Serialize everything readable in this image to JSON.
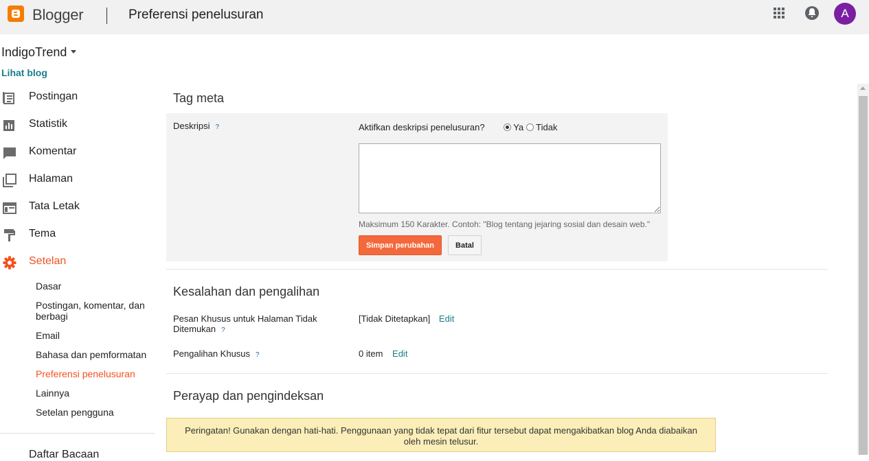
{
  "header": {
    "brand": "Blogger",
    "title": "Preferensi penelusuran",
    "avatar_initial": "A",
    "accent_color": "#f57d00",
    "avatar_color": "#7b1fa2"
  },
  "sidebar": {
    "blog_name": "IndigoTrend",
    "view_blog": "Lihat blog",
    "items": [
      {
        "label": "Postingan",
        "icon": "posts-icon"
      },
      {
        "label": "Statistik",
        "icon": "stats-icon"
      },
      {
        "label": "Komentar",
        "icon": "comments-icon"
      },
      {
        "label": "Halaman",
        "icon": "pages-icon"
      },
      {
        "label": "Tata Letak",
        "icon": "layout-icon"
      },
      {
        "label": "Tema",
        "icon": "theme-icon"
      },
      {
        "label": "Setelan",
        "icon": "gear-icon",
        "active": true
      }
    ],
    "subitems": [
      {
        "label": "Dasar"
      },
      {
        "label": "Postingan, komentar, dan berbagi"
      },
      {
        "label": "Email"
      },
      {
        "label": "Bahasa dan pemformatan"
      },
      {
        "label": "Preferensi penelusuran",
        "active": true
      },
      {
        "label": "Lainnya"
      },
      {
        "label": "Setelan pengguna"
      }
    ],
    "cut_item": "Daftar Bacaan"
  },
  "meta": {
    "section_title": "Tag meta",
    "desc_label": "Deskripsi",
    "help": "?",
    "enable_question": "Aktifkan deskripsi penelusuran?",
    "yes": "Ya",
    "no": "Tidak",
    "textarea_value": "",
    "hint": "Maksimum 150 Karakter. Contoh: \"Blog tentang jejaring sosial dan desain web.\"",
    "save": "Simpan perubahan",
    "cancel": "Batal"
  },
  "errors": {
    "section_title": "Kesalahan dan pengalihan",
    "notfound_label": "Pesan Khusus untuk Halaman Tidak Ditemukan",
    "notfound_value": "[Tidak Ditetapkan]",
    "edit": "Edit",
    "redirect_label": "Pengalihan Khusus",
    "redirect_value": "0 item"
  },
  "crawl": {
    "section_title": "Perayap dan pengindeksan",
    "warning": "Peringatan! Gunakan dengan hati-hati. Penggunaan yang tidak tepat dari fitur tersebut dapat mengakibatkan blog Anda diabaikan oleh mesin telusur."
  }
}
